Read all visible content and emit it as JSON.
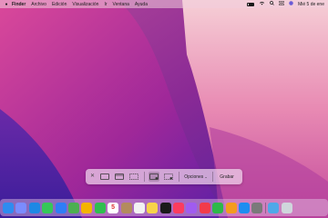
{
  "menubar": {
    "app_name": "Finder",
    "menus": [
      "Archivo",
      "Edición",
      "Visualización",
      "Ir",
      "Ventana",
      "Ayuda"
    ],
    "clock": "Mié 5 de ene"
  },
  "screenshot_toolbar": {
    "options_label": "Opciones",
    "capture_label": "Grabar",
    "tools": [
      {
        "icon": "capture-entire-screen-icon",
        "active": false
      },
      {
        "icon": "capture-window-icon",
        "active": false
      },
      {
        "icon": "capture-selection-icon",
        "active": false
      },
      {
        "icon": "record-entire-screen-icon",
        "active": true
      },
      {
        "icon": "record-selection-icon",
        "active": false
      }
    ]
  },
  "dock": {
    "calendar_day": "5",
    "apps": [
      {
        "name": "finder-icon",
        "color": "#2e8cf0"
      },
      {
        "name": "launchpad-icon",
        "color": "#7b8cff"
      },
      {
        "name": "safari-icon",
        "color": "#1e88e5"
      },
      {
        "name": "messages-icon",
        "color": "#35c759"
      },
      {
        "name": "mail-icon",
        "color": "#2f7df6"
      },
      {
        "name": "maps-icon",
        "color": "#4caf50"
      },
      {
        "name": "photos-icon",
        "color": "#f4b400"
      },
      {
        "name": "facetime-icon",
        "color": "#2fbf4f"
      },
      {
        "name": "calendar-icon",
        "color": "#ffffff"
      },
      {
        "name": "contacts-icon",
        "color": "#b38b5d"
      },
      {
        "name": "reminders-icon",
        "color": "#f2f2f2"
      },
      {
        "name": "notes-icon",
        "color": "#f7d34a"
      },
      {
        "name": "tv-icon",
        "color": "#1a1a1a"
      },
      {
        "name": "music-icon",
        "color": "#fb3c5e"
      },
      {
        "name": "podcasts-icon",
        "color": "#a05cf0"
      },
      {
        "name": "news-icon",
        "color": "#f23b4a"
      },
      {
        "name": "numbers-icon",
        "color": "#2db84a"
      },
      {
        "name": "pages-icon",
        "color": "#f49b1f"
      },
      {
        "name": "app-store-icon",
        "color": "#1d8df0"
      },
      {
        "name": "system-preferences-icon",
        "color": "#7a7a7a"
      }
    ],
    "trailing": [
      {
        "name": "downloads-icon",
        "color": "#4fa8e8"
      },
      {
        "name": "trash-icon",
        "color": "#cfd6dc"
      }
    ]
  }
}
